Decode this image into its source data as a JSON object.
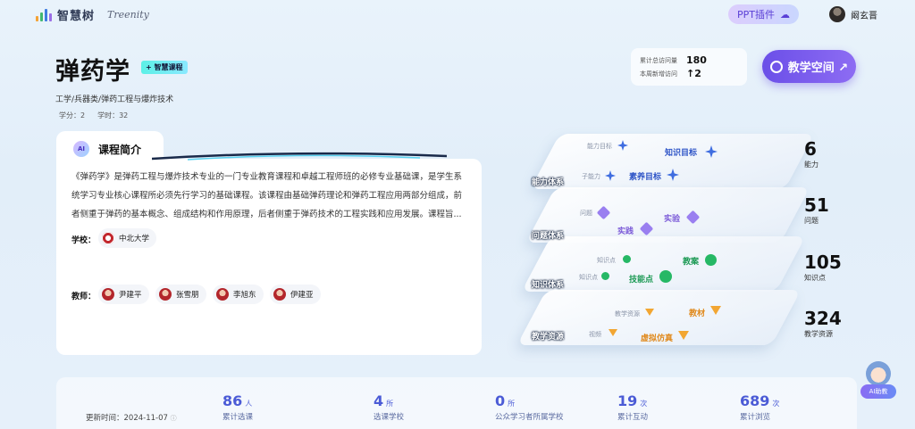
{
  "header": {
    "logo_text": "智慧树",
    "logo_sub": "Treenity",
    "ppt_button": "PPT插件",
    "user_name": "阚玄晋"
  },
  "course": {
    "title": "弹药学",
    "tag": "+ 智慧课程",
    "breadcrumb": "工学/兵器类/弹药工程与爆炸技术",
    "credits": "学分：2",
    "hours": "学时：32"
  },
  "visits": {
    "total_label": "累计总访问量",
    "total_value": "180",
    "week_label": "本周新增访问",
    "week_value": "↑2"
  },
  "space_button": "教学空间 ↗",
  "intro": {
    "ai_badge": "AI",
    "title": "课程简介",
    "text": "《弹药学》是弹药工程与爆炸技术专业的一门专业教育课程和卓越工程师班的必修专业基础课，是学生系统学习专业核心课程所必须先行学习的基础课程。该课程由基础弹药理论和弹药工程应用两部分组成，前者侧重于弹药的基本概念、组成结构和作用原理，后者侧重于弹药技术的工程实践和应用发展。课程旨...",
    "school_label": "学校：",
    "school": "中北大学",
    "teacher_label": "教师：",
    "teachers": [
      "尹建平",
      "张雪朋",
      "李旭东",
      "伊建亚"
    ]
  },
  "layers": {
    "ability": {
      "label": "能力体系",
      "n1": "能力目标",
      "n2": "知识目标",
      "n3": "子能力",
      "n4": "素养目标"
    },
    "question": {
      "label": "问题体系",
      "n1": "问题",
      "n2": "实验",
      "n3": "实践"
    },
    "knowledge": {
      "label": "知识体系",
      "n1": "知识点",
      "n2": "教案",
      "n3": "知识点",
      "n4": "技能点"
    },
    "resource": {
      "label": "教学资源",
      "n1": "教学资源",
      "n2": "教材",
      "n3": "视频",
      "n4": "虚拟仿真"
    }
  },
  "stats": [
    {
      "value": "6",
      "label": "能力"
    },
    {
      "value": "51",
      "label": "问题"
    },
    {
      "value": "105",
      "label": "知识点"
    },
    {
      "value": "324",
      "label": "教学资源"
    }
  ],
  "bottom": {
    "updated": "更新时间：2024-11-07",
    "items": [
      {
        "value": "86",
        "unit": "人",
        "label": "累计选课"
      },
      {
        "value": "4",
        "unit": "所",
        "label": "选课学校"
      },
      {
        "value": "0",
        "unit": "所",
        "label": "公众学习者所属学校"
      },
      {
        "value": "19",
        "unit": "次",
        "label": "累计互动"
      },
      {
        "value": "689",
        "unit": "次",
        "label": "累计浏览"
      }
    ]
  },
  "helper_label": "AI助教",
  "colors": {
    "accent": "#6b4fe8",
    "stat_blue": "#4b5bd6"
  }
}
